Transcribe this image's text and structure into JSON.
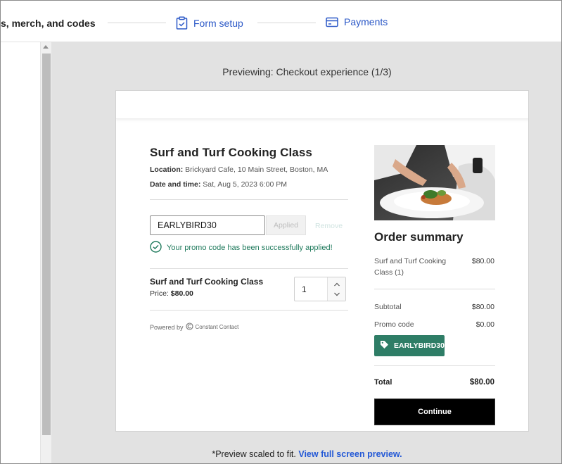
{
  "stepper": {
    "partial_step_label": "s, merch, and codes",
    "form_setup_label": "Form setup",
    "payments_label": "Payments"
  },
  "preview": {
    "heading": "Previewing: Checkout experience (1/3)",
    "footer_text": "*Preview scaled to fit.",
    "footer_link": "View full screen preview."
  },
  "event": {
    "title": "Surf and Turf Cooking Class",
    "location_label": "Location:",
    "location_value": "Brickyard Cafe, 10 Main Street, Boston, MA",
    "datetime_label": "Date and time:",
    "datetime_value": "Sat, Aug 5, 2023 6:00 PM"
  },
  "promo": {
    "code_value": "EARLYBIRD30",
    "applied_label": "Applied",
    "remove_label": "Remove",
    "success_message": "Your promo code has been successfully applied!"
  },
  "item": {
    "name": "Surf and Turf Cooking Class",
    "price_label": "Price:",
    "price_value": "$80.00",
    "quantity": "1"
  },
  "powered_by": {
    "label": "Powered by",
    "brand": "Constant Contact"
  },
  "summary": {
    "title": "Order summary",
    "line_item_label": "Surf and Turf Cooking Class (1)",
    "line_item_value": "$80.00",
    "subtotal_label": "Subtotal",
    "subtotal_value": "$80.00",
    "promo_label": "Promo code",
    "promo_value": "$0.00",
    "promo_tag": "EARLYBIRD30",
    "total_label": "Total",
    "total_value": "$80.00",
    "continue_label": "Continue"
  },
  "colors": {
    "link_blue": "#2b58c7",
    "success_green": "#1f7a5c",
    "promo_tag_green": "#2e7d66",
    "continue_black": "#000000",
    "preview_bg": "#e2e2e2"
  },
  "icons": {
    "form_setup": "clipboard-check-icon",
    "payments": "credit-card-icon",
    "success": "check-circle-icon",
    "promo_tag": "tag-icon",
    "qty_up": "chevron-up-icon",
    "qty_down": "chevron-down-icon",
    "brand": "constant-contact-logo-icon"
  }
}
